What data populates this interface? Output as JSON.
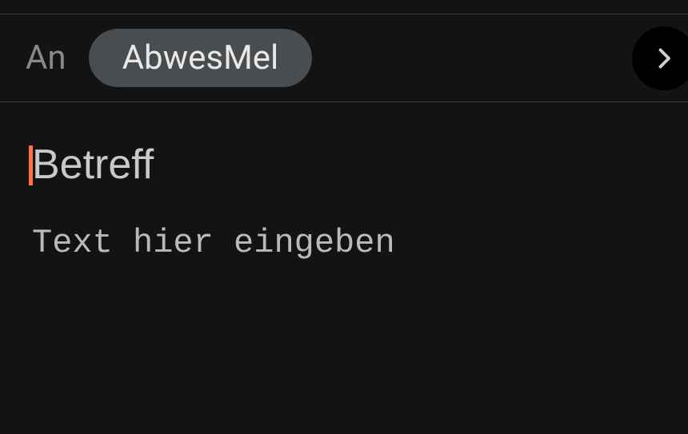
{
  "compose": {
    "to_label": "An",
    "recipient_chip": "AbwesMel",
    "subject_placeholder": "Betreff",
    "subject_value": "",
    "body_placeholder": "Text hier eingeben",
    "body_value": ""
  }
}
